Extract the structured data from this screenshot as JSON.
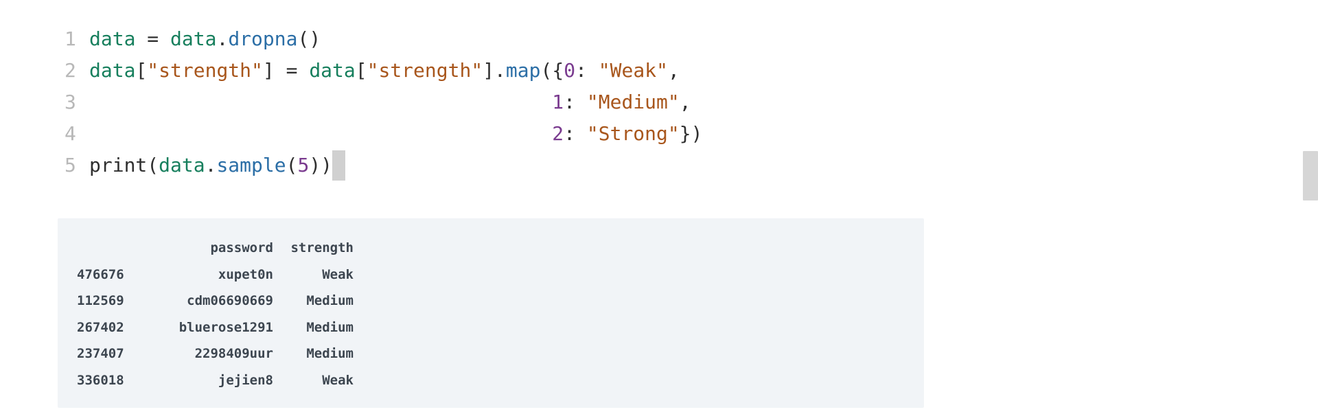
{
  "code": {
    "lines": [
      {
        "num": "1",
        "tokens": [
          {
            "t": "data",
            "c": "var"
          },
          {
            "t": " = ",
            "c": "plain"
          },
          {
            "t": "data",
            "c": "var"
          },
          {
            "t": ".",
            "c": "plain"
          },
          {
            "t": "dropna",
            "c": "fn"
          },
          {
            "t": "()",
            "c": "plain"
          }
        ]
      },
      {
        "num": "2",
        "tokens": [
          {
            "t": "data",
            "c": "var"
          },
          {
            "t": "[",
            "c": "plain"
          },
          {
            "t": "\"strength\"",
            "c": "str"
          },
          {
            "t": "] = ",
            "c": "plain"
          },
          {
            "t": "data",
            "c": "var"
          },
          {
            "t": "[",
            "c": "plain"
          },
          {
            "t": "\"strength\"",
            "c": "str"
          },
          {
            "t": "].",
            "c": "plain"
          },
          {
            "t": "map",
            "c": "fn"
          },
          {
            "t": "({",
            "c": "plain"
          },
          {
            "t": "0",
            "c": "num"
          },
          {
            "t": ": ",
            "c": "plain"
          },
          {
            "t": "\"Weak\"",
            "c": "str"
          },
          {
            "t": ",",
            "c": "plain"
          }
        ]
      },
      {
        "num": "3",
        "tokens": [
          {
            "t": "                                        ",
            "c": "plain"
          },
          {
            "t": "1",
            "c": "num"
          },
          {
            "t": ": ",
            "c": "plain"
          },
          {
            "t": "\"Medium\"",
            "c": "str"
          },
          {
            "t": ",",
            "c": "plain"
          }
        ]
      },
      {
        "num": "4",
        "tokens": [
          {
            "t": "                                        ",
            "c": "plain"
          },
          {
            "t": "2",
            "c": "num"
          },
          {
            "t": ": ",
            "c": "plain"
          },
          {
            "t": "\"Strong\"",
            "c": "str"
          },
          {
            "t": "})",
            "c": "plain"
          }
        ]
      },
      {
        "num": "5",
        "tokens": [
          {
            "t": "print",
            "c": "plain"
          },
          {
            "t": "(",
            "c": "plain"
          },
          {
            "t": "data",
            "c": "var"
          },
          {
            "t": ".",
            "c": "plain"
          },
          {
            "t": "sample",
            "c": "fn"
          },
          {
            "t": "(",
            "c": "plain"
          },
          {
            "t": "5",
            "c": "num"
          },
          {
            "t": "))",
            "c": "plain"
          }
        ],
        "cursor": true
      }
    ]
  },
  "output": {
    "headers": [
      "",
      "password",
      "strength"
    ],
    "rows": [
      [
        "476676",
        "xupet0n",
        "Weak"
      ],
      [
        "112569",
        "cdm06690669",
        "Medium"
      ],
      [
        "267402",
        "bluerose1291",
        "Medium"
      ],
      [
        "237407",
        "2298409uur",
        "Medium"
      ],
      [
        "336018",
        "jejien8",
        "Weak"
      ]
    ]
  }
}
